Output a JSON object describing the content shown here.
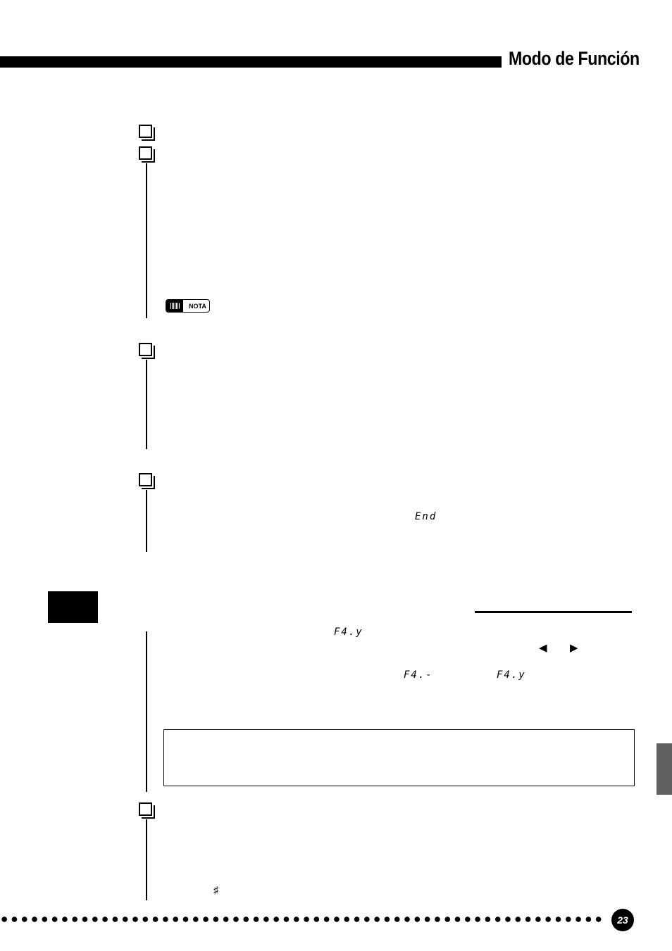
{
  "header": {
    "title": "Modo de Función"
  },
  "nota": {
    "label": "NOTA",
    "icon": "speech-bubble-keyboard-icon"
  },
  "lcd": {
    "end": "End",
    "f4y_1": "F4.y",
    "f4dash": "F4.-",
    "f4y_2": "F4.y"
  },
  "arrows": {
    "left": "◀",
    "right": "▶"
  },
  "symbols": {
    "sharp": "♯"
  },
  "footer": {
    "page_number": "23"
  }
}
